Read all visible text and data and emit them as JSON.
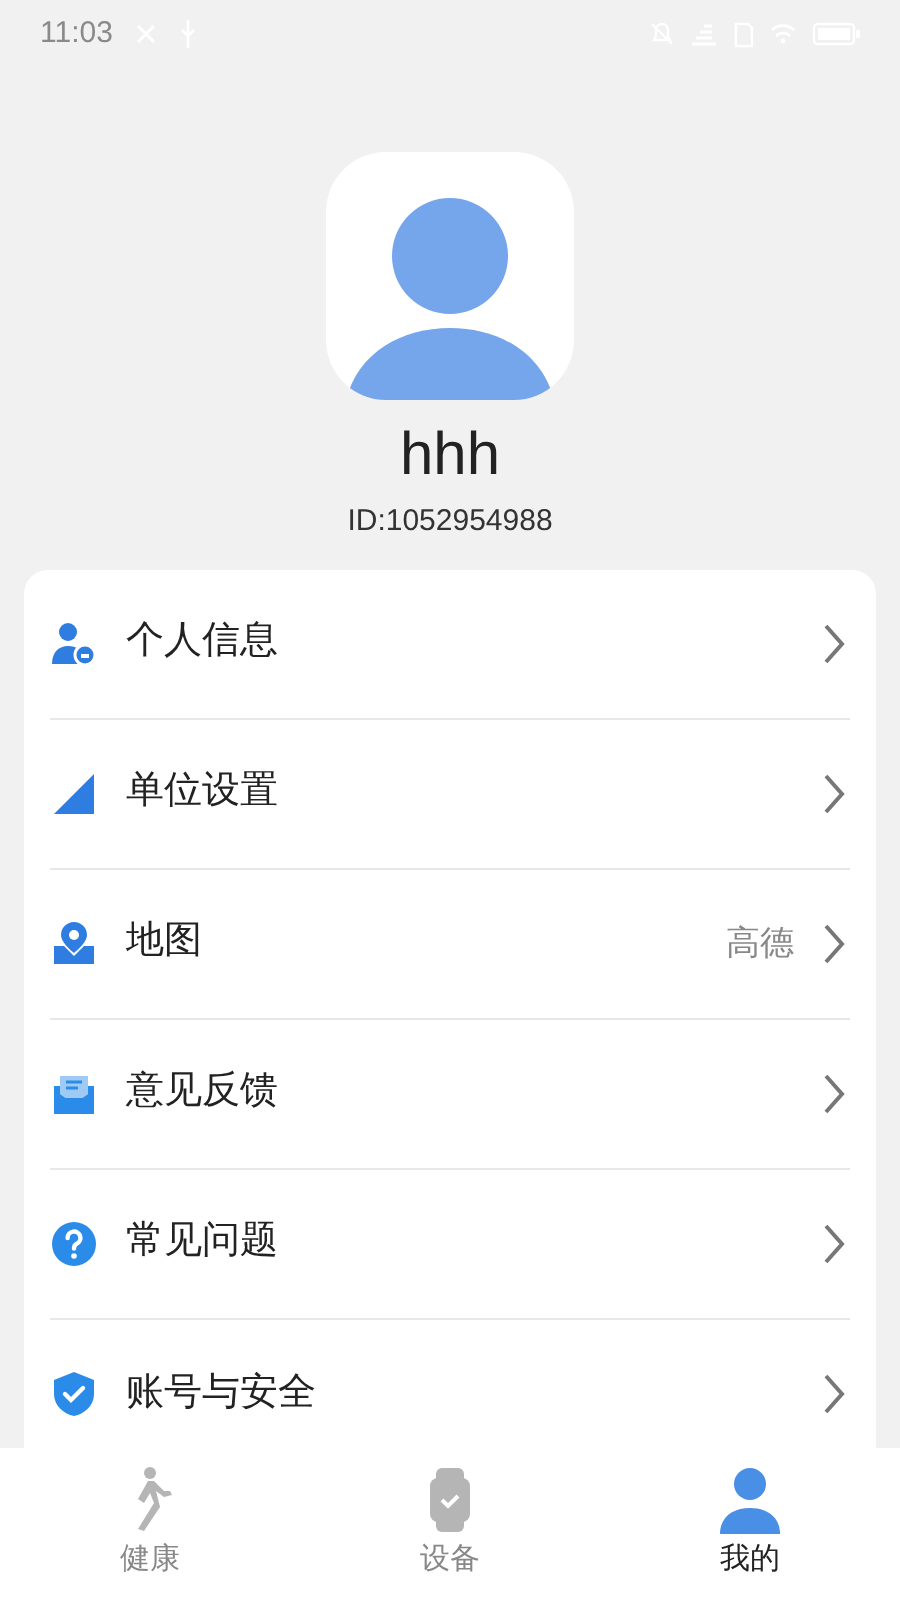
{
  "status_bar": {
    "time": "11:03"
  },
  "profile": {
    "name": "hhh",
    "id": "ID:1052954988"
  },
  "menu": [
    {
      "kind": "person",
      "label": "个人信息"
    },
    {
      "kind": "triangle",
      "label": "单位设置"
    },
    {
      "kind": "map",
      "label": "地图",
      "value": "高德"
    },
    {
      "kind": "mail",
      "label": "意见反馈"
    },
    {
      "kind": "question",
      "label": "常见问题"
    },
    {
      "kind": "shield",
      "label": "账号与安全"
    }
  ],
  "tabs": [
    {
      "kind": "walk",
      "label": "健康",
      "selected": false
    },
    {
      "kind": "watch",
      "label": "设备",
      "selected": false
    },
    {
      "kind": "user",
      "label": "我的",
      "selected": true
    }
  ]
}
